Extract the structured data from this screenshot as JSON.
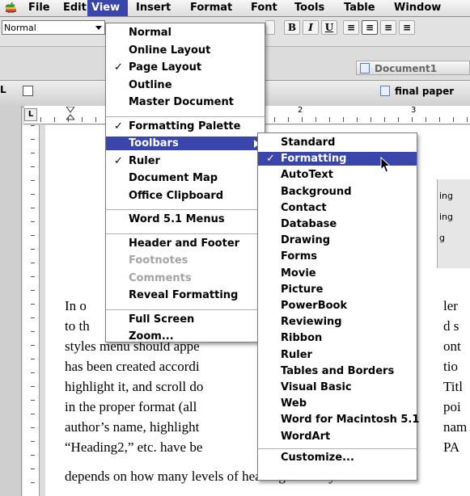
{
  "menubar": {
    "items": [
      "File",
      "Edit",
      "View",
      "Insert",
      "Format",
      "Font",
      "Tools",
      "Table",
      "Window"
    ],
    "active": "View"
  },
  "toolbar": {
    "style_value": "Normal",
    "bold": "B",
    "italic": "I",
    "underline": "U",
    "doc1_title": "Document1",
    "doc2_title": "final paper"
  },
  "ruler": {
    "mark2": "2",
    "mark3": "3"
  },
  "side_panel": [
    "ing",
    "ing",
    "g"
  ],
  "document": {
    "lines": [
      {
        "left": "In o",
        "right": "ler"
      },
      {
        "left": "to th",
        "right": "d s"
      },
      {
        "left": "styles menu should appe",
        "right": "ont"
      },
      {
        "left": "has been created accordi",
        "right": "tio"
      },
      {
        "left": "highlight it, and scroll do",
        "right": "Titl"
      },
      {
        "left": "in the proper format (all",
        "right": "poi"
      },
      {
        "left": "author’s name, highlight",
        "right": "nam"
      },
      {
        "left": "“Heading2,” etc. have be",
        "right": "PA"
      },
      {
        "left": "depends on how many levels of headings are in your",
        "right": ""
      }
    ]
  },
  "view_menu": {
    "items": [
      {
        "label": "Normal",
        "checked": false,
        "disabled": false
      },
      {
        "label": "Online Layout",
        "checked": false,
        "disabled": false
      },
      {
        "label": "Page Layout",
        "checked": true,
        "disabled": false
      },
      {
        "label": "Outline",
        "checked": false,
        "disabled": false
      },
      {
        "label": "Master Document",
        "checked": false,
        "disabled": false
      },
      {
        "sep": true
      },
      {
        "label": "Formatting Palette",
        "checked": true,
        "disabled": false
      },
      {
        "label": "Toolbars",
        "checked": false,
        "disabled": false,
        "highlighted": true,
        "submenu": true
      },
      {
        "label": "Ruler",
        "checked": true,
        "disabled": false
      },
      {
        "label": "Document Map",
        "checked": false,
        "disabled": false
      },
      {
        "label": "Office Clipboard",
        "checked": false,
        "disabled": false
      },
      {
        "sep": true
      },
      {
        "label": "Word 5.1 Menus",
        "checked": false,
        "disabled": false
      },
      {
        "sep": true
      },
      {
        "label": "Header and Footer",
        "checked": false,
        "disabled": false
      },
      {
        "label": "Footnotes",
        "checked": false,
        "disabled": true
      },
      {
        "label": "Comments",
        "checked": false,
        "disabled": true
      },
      {
        "label": "Reveal Formatting",
        "checked": false,
        "disabled": false
      },
      {
        "sep": true
      },
      {
        "label": "Full Screen",
        "checked": false,
        "disabled": false
      },
      {
        "label": "Zoom...",
        "checked": false,
        "disabled": false
      }
    ]
  },
  "toolbars_menu": {
    "items": [
      {
        "label": "Standard",
        "checked": false
      },
      {
        "label": "Formatting",
        "checked": true,
        "highlighted": true
      },
      {
        "label": "AutoText",
        "checked": false
      },
      {
        "label": "Background",
        "checked": false
      },
      {
        "label": "Contact",
        "checked": false
      },
      {
        "label": "Database",
        "checked": false
      },
      {
        "label": "Drawing",
        "checked": false
      },
      {
        "label": "Forms",
        "checked": false
      },
      {
        "label": "Movie",
        "checked": false
      },
      {
        "label": "Picture",
        "checked": false
      },
      {
        "label": "PowerBook",
        "checked": false
      },
      {
        "label": "Reviewing",
        "checked": false
      },
      {
        "label": "Ribbon",
        "checked": false
      },
      {
        "label": "Ruler",
        "checked": false
      },
      {
        "label": "Tables and Borders",
        "checked": false
      },
      {
        "label": "Visual Basic",
        "checked": false
      },
      {
        "label": "Web",
        "checked": false
      },
      {
        "label": "Word for Macintosh 5.1",
        "checked": false
      },
      {
        "label": "WordArt",
        "checked": false
      },
      {
        "sep": true
      },
      {
        "label": "Customize...",
        "checked": false
      }
    ]
  },
  "colors": {
    "highlight": "#3b46ac",
    "menu_bg": "#ffffff",
    "disabled": "#a4a4a4"
  },
  "icons": {
    "apple": "apple-icon",
    "cursor": "arrow-cursor-icon",
    "check": "checkmark-icon"
  }
}
